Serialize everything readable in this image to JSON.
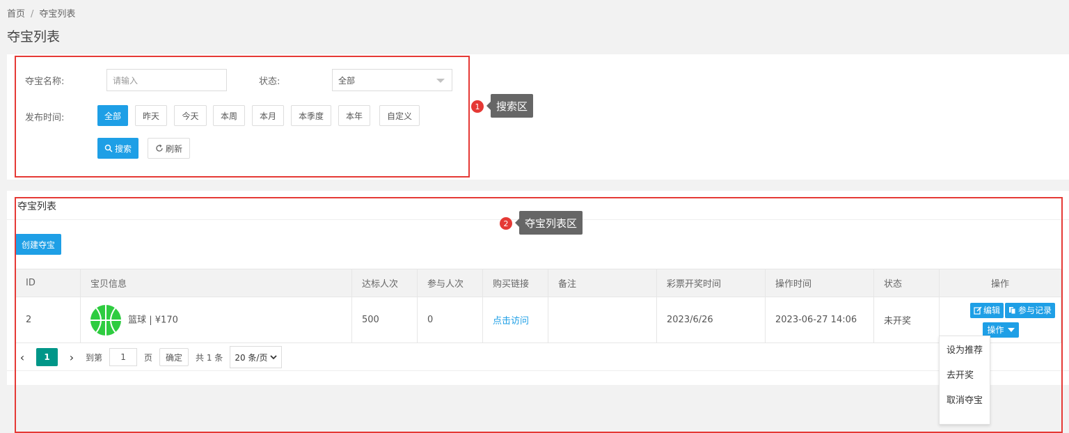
{
  "breadcrumb": {
    "home": "首页",
    "separator": "/",
    "current": "夺宝列表"
  },
  "page_title": "夺宝列表",
  "search": {
    "name_label": "夺宝名称:",
    "name_placeholder": "请输入",
    "status_label": "状态:",
    "status_value": "全部",
    "time_label": "发布时间:",
    "time_options": [
      "全部",
      "昨天",
      "今天",
      "本周",
      "本月",
      "本季度",
      "本年",
      "自定义"
    ],
    "search_button": "搜索",
    "refresh_button": "刷新"
  },
  "annotations": {
    "one": {
      "number": "1",
      "text": "搜索区"
    },
    "two": {
      "number": "2",
      "text": "夺宝列表区"
    }
  },
  "list": {
    "title": "夺宝列表",
    "create_button": "创建夺宝",
    "columns": [
      "ID",
      "宝贝信息",
      "达标人次",
      "参与人次",
      "购买链接",
      "备注",
      "彩票开奖时间",
      "操作时间",
      "状态",
      "操作"
    ],
    "rows": [
      {
        "id": "2",
        "product": "篮球 | ¥170",
        "target": "500",
        "joined": "0",
        "link": "点击访问",
        "remark": "",
        "draw_time": "2023/6/26",
        "op_time": "2023-06-27 14:06",
        "status": "未开奖"
      }
    ],
    "actions": {
      "edit": "编辑",
      "records": "参与记录",
      "more": "操作"
    },
    "menu": [
      "设为推荐",
      "去开奖",
      "取消夺宝"
    ]
  },
  "pager": {
    "current_page": "1",
    "goto_label": "到第",
    "goto_value": "1",
    "page_unit": "页",
    "confirm": "确定",
    "total": "共 1 条",
    "page_size": "20 条/页"
  },
  "colors": {
    "primary": "#1e9fe6",
    "page_active": "#009688",
    "highlight": "#e53935"
  }
}
